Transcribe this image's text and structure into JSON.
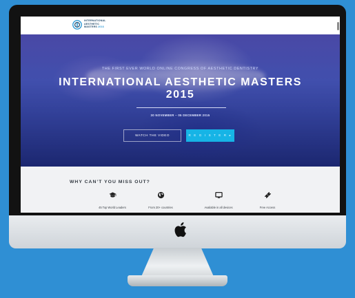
{
  "header": {
    "logo_lines": [
      "INTERNATIONAL",
      "AESTHETIC",
      "MASTERS"
    ],
    "logo_year": "2016"
  },
  "hero": {
    "kicker": "THE FIRST EVER WORLD ONLINE CONGRESS OF AESTHETIC DENTISTRY",
    "title_line1": "INTERNATIONAL AESTHETIC MASTERS",
    "title_line2": "2015",
    "dates": "30 NOVEMBER – 05 DECEMBER 2015",
    "watch_button": "WATCH THE VIDEO",
    "register_button": "R E G I S T E R  ▸"
  },
  "why": {
    "title": "WHY CAN’T YOU MISS OUT?",
    "features": [
      {
        "icon": "graduation-cap-icon",
        "label": "45 Top World Leaders"
      },
      {
        "icon": "globe-icon",
        "label": "From 20+ countries"
      },
      {
        "icon": "monitor-icon",
        "label": "Available in all devices"
      },
      {
        "icon": "ticket-icon",
        "label": "Free Access"
      }
    ]
  },
  "colors": {
    "background": "#2f8fd4",
    "accent": "#16b4e6"
  }
}
